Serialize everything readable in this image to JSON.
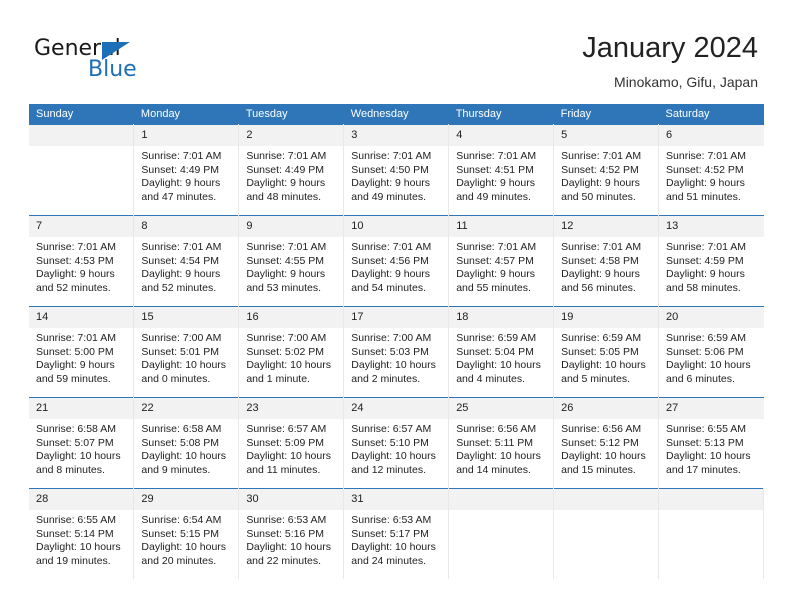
{
  "brand": {
    "name_part1": "General",
    "name_part2": "Blue",
    "triangle_icon": "triangle-icon",
    "accent_color": "#1d6fb8"
  },
  "header": {
    "title": "January 2024",
    "subtitle": "Minokamo, Gifu, Japan"
  },
  "calendar": {
    "header_bg": "#2e76b8",
    "daynum_bg": "#f2f2f2",
    "weekdays": [
      "Sunday",
      "Monday",
      "Tuesday",
      "Wednesday",
      "Thursday",
      "Friday",
      "Saturday"
    ],
    "weeks": [
      [
        {
          "day": "",
          "lines": []
        },
        {
          "day": "1",
          "lines": [
            "Sunrise: 7:01 AM",
            "Sunset: 4:49 PM",
            "Daylight: 9 hours",
            "and 47 minutes."
          ]
        },
        {
          "day": "2",
          "lines": [
            "Sunrise: 7:01 AM",
            "Sunset: 4:49 PM",
            "Daylight: 9 hours",
            "and 48 minutes."
          ]
        },
        {
          "day": "3",
          "lines": [
            "Sunrise: 7:01 AM",
            "Sunset: 4:50 PM",
            "Daylight: 9 hours",
            "and 49 minutes."
          ]
        },
        {
          "day": "4",
          "lines": [
            "Sunrise: 7:01 AM",
            "Sunset: 4:51 PM",
            "Daylight: 9 hours",
            "and 49 minutes."
          ]
        },
        {
          "day": "5",
          "lines": [
            "Sunrise: 7:01 AM",
            "Sunset: 4:52 PM",
            "Daylight: 9 hours",
            "and 50 minutes."
          ]
        },
        {
          "day": "6",
          "lines": [
            "Sunrise: 7:01 AM",
            "Sunset: 4:52 PM",
            "Daylight: 9 hours",
            "and 51 minutes."
          ]
        }
      ],
      [
        {
          "day": "7",
          "lines": [
            "Sunrise: 7:01 AM",
            "Sunset: 4:53 PM",
            "Daylight: 9 hours",
            "and 52 minutes."
          ]
        },
        {
          "day": "8",
          "lines": [
            "Sunrise: 7:01 AM",
            "Sunset: 4:54 PM",
            "Daylight: 9 hours",
            "and 52 minutes."
          ]
        },
        {
          "day": "9",
          "lines": [
            "Sunrise: 7:01 AM",
            "Sunset: 4:55 PM",
            "Daylight: 9 hours",
            "and 53 minutes."
          ]
        },
        {
          "day": "10",
          "lines": [
            "Sunrise: 7:01 AM",
            "Sunset: 4:56 PM",
            "Daylight: 9 hours",
            "and 54 minutes."
          ]
        },
        {
          "day": "11",
          "lines": [
            "Sunrise: 7:01 AM",
            "Sunset: 4:57 PM",
            "Daylight: 9 hours",
            "and 55 minutes."
          ]
        },
        {
          "day": "12",
          "lines": [
            "Sunrise: 7:01 AM",
            "Sunset: 4:58 PM",
            "Daylight: 9 hours",
            "and 56 minutes."
          ]
        },
        {
          "day": "13",
          "lines": [
            "Sunrise: 7:01 AM",
            "Sunset: 4:59 PM",
            "Daylight: 9 hours",
            "and 58 minutes."
          ]
        }
      ],
      [
        {
          "day": "14",
          "lines": [
            "Sunrise: 7:01 AM",
            "Sunset: 5:00 PM",
            "Daylight: 9 hours",
            "and 59 minutes."
          ]
        },
        {
          "day": "15",
          "lines": [
            "Sunrise: 7:00 AM",
            "Sunset: 5:01 PM",
            "Daylight: 10 hours",
            "and 0 minutes."
          ]
        },
        {
          "day": "16",
          "lines": [
            "Sunrise: 7:00 AM",
            "Sunset: 5:02 PM",
            "Daylight: 10 hours",
            "and 1 minute."
          ]
        },
        {
          "day": "17",
          "lines": [
            "Sunrise: 7:00 AM",
            "Sunset: 5:03 PM",
            "Daylight: 10 hours",
            "and 2 minutes."
          ]
        },
        {
          "day": "18",
          "lines": [
            "Sunrise: 6:59 AM",
            "Sunset: 5:04 PM",
            "Daylight: 10 hours",
            "and 4 minutes."
          ]
        },
        {
          "day": "19",
          "lines": [
            "Sunrise: 6:59 AM",
            "Sunset: 5:05 PM",
            "Daylight: 10 hours",
            "and 5 minutes."
          ]
        },
        {
          "day": "20",
          "lines": [
            "Sunrise: 6:59 AM",
            "Sunset: 5:06 PM",
            "Daylight: 10 hours",
            "and 6 minutes."
          ]
        }
      ],
      [
        {
          "day": "21",
          "lines": [
            "Sunrise: 6:58 AM",
            "Sunset: 5:07 PM",
            "Daylight: 10 hours",
            "and 8 minutes."
          ]
        },
        {
          "day": "22",
          "lines": [
            "Sunrise: 6:58 AM",
            "Sunset: 5:08 PM",
            "Daylight: 10 hours",
            "and 9 minutes."
          ]
        },
        {
          "day": "23",
          "lines": [
            "Sunrise: 6:57 AM",
            "Sunset: 5:09 PM",
            "Daylight: 10 hours",
            "and 11 minutes."
          ]
        },
        {
          "day": "24",
          "lines": [
            "Sunrise: 6:57 AM",
            "Sunset: 5:10 PM",
            "Daylight: 10 hours",
            "and 12 minutes."
          ]
        },
        {
          "day": "25",
          "lines": [
            "Sunrise: 6:56 AM",
            "Sunset: 5:11 PM",
            "Daylight: 10 hours",
            "and 14 minutes."
          ]
        },
        {
          "day": "26",
          "lines": [
            "Sunrise: 6:56 AM",
            "Sunset: 5:12 PM",
            "Daylight: 10 hours",
            "and 15 minutes."
          ]
        },
        {
          "day": "27",
          "lines": [
            "Sunrise: 6:55 AM",
            "Sunset: 5:13 PM",
            "Daylight: 10 hours",
            "and 17 minutes."
          ]
        }
      ],
      [
        {
          "day": "28",
          "lines": [
            "Sunrise: 6:55 AM",
            "Sunset: 5:14 PM",
            "Daylight: 10 hours",
            "and 19 minutes."
          ]
        },
        {
          "day": "29",
          "lines": [
            "Sunrise: 6:54 AM",
            "Sunset: 5:15 PM",
            "Daylight: 10 hours",
            "and 20 minutes."
          ]
        },
        {
          "day": "30",
          "lines": [
            "Sunrise: 6:53 AM",
            "Sunset: 5:16 PM",
            "Daylight: 10 hours",
            "and 22 minutes."
          ]
        },
        {
          "day": "31",
          "lines": [
            "Sunrise: 6:53 AM",
            "Sunset: 5:17 PM",
            "Daylight: 10 hours",
            "and 24 minutes."
          ]
        },
        {
          "day": "",
          "lines": []
        },
        {
          "day": "",
          "lines": []
        },
        {
          "day": "",
          "lines": []
        }
      ]
    ]
  }
}
